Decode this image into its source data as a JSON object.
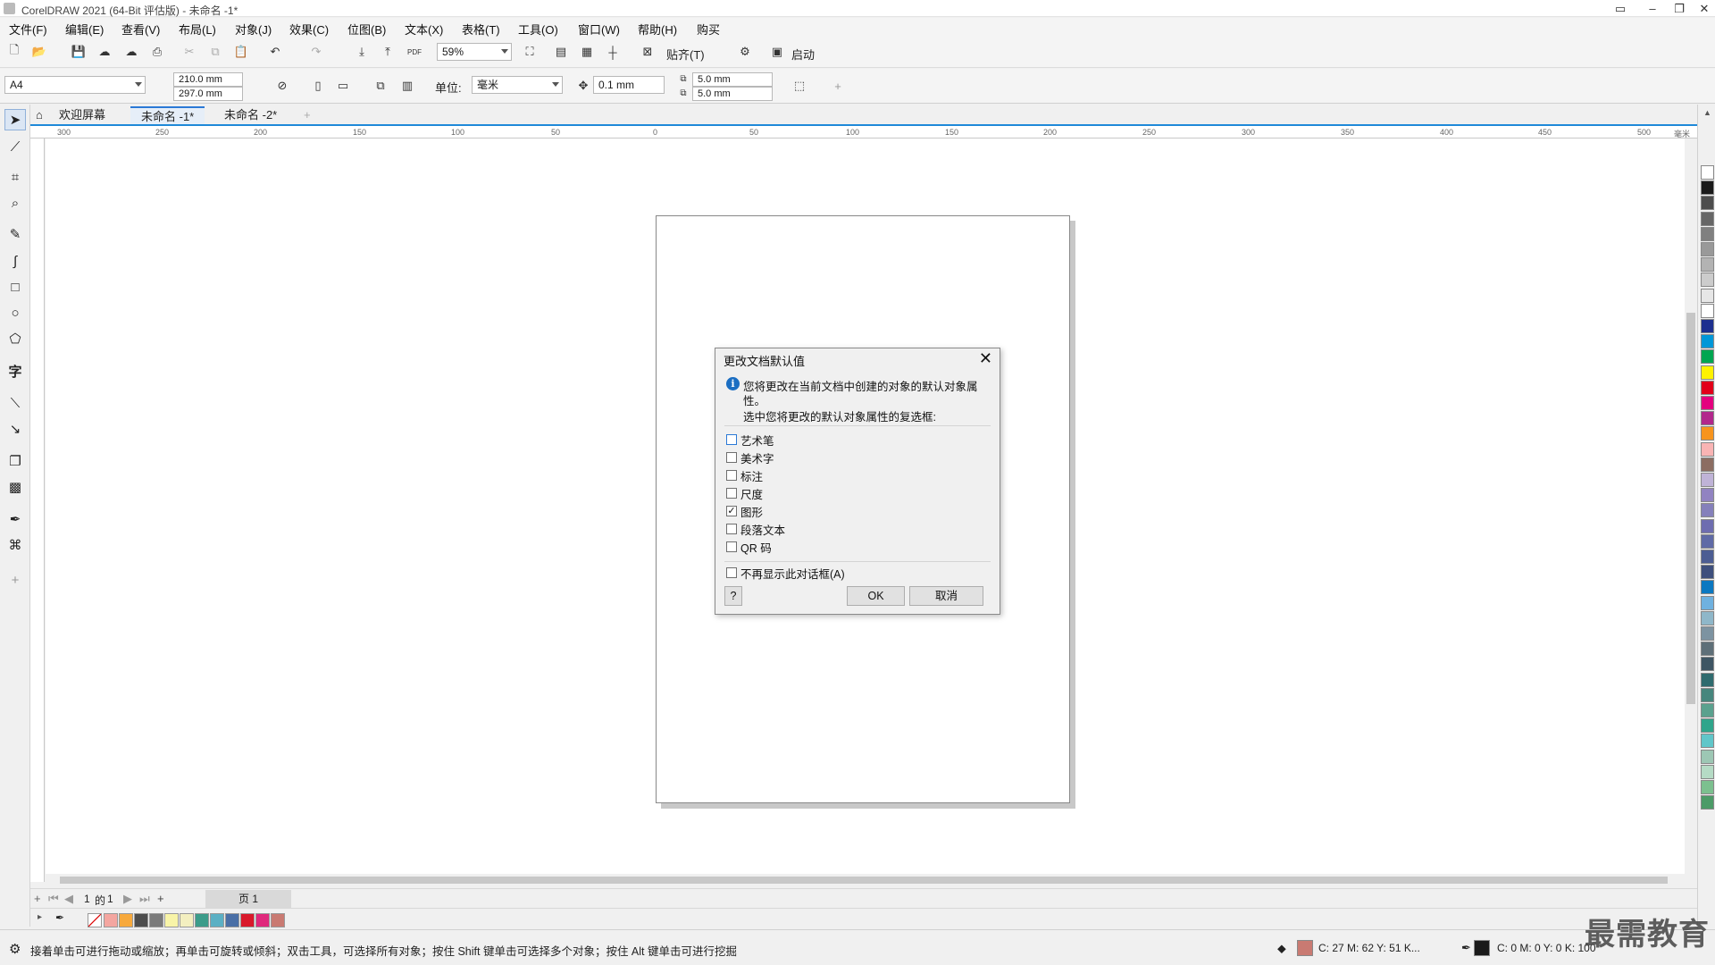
{
  "window": {
    "title": "CorelDRAW 2021 (64-Bit 评估版) - 未命名 -1*"
  },
  "menu": [
    "文件(F)",
    "编辑(E)",
    "查看(V)",
    "布局(L)",
    "对象(J)",
    "效果(C)",
    "位图(B)",
    "文本(X)",
    "表格(T)",
    "工具(O)",
    "窗口(W)",
    "帮助(H)",
    "购买"
  ],
  "toolbar": {
    "zoom": "59%",
    "snap_label": "贴齐(T)",
    "launch_label": "启动"
  },
  "property_bar": {
    "page_size": "A4",
    "width": "210.0 mm",
    "height": "297.0 mm",
    "units_label": "单位:",
    "units_value": "毫米",
    "nudge": "0.1 mm",
    "dup_x": "5.0 mm",
    "dup_y": "5.0 mm"
  },
  "tabs": [
    "欢迎屏幕",
    "未命名 -1*",
    "未命名 -2*"
  ],
  "ruler": {
    "h_ticks": [
      "300",
      "250",
      "200",
      "150",
      "100",
      "50",
      "0",
      "50",
      "100",
      "150",
      "200",
      "250",
      "300",
      "350",
      "400",
      "450",
      "500"
    ],
    "unit": "毫米"
  },
  "page_nav": {
    "current": "1",
    "of_label": "的",
    "total": "1",
    "page_tab": "页 1"
  },
  "status": {
    "hint": "接着单击可进行拖动或缩放；再单击可旋转或倾斜；双击工具，可选择所有对象；按住 Shift 键单击可选择多个对象；按住 Alt 键单击可进行挖掘",
    "fill_values": "C: 27 M: 62 Y: 51 K...",
    "outline_values": "C: 0 M: 0 Y: 0 K: 100"
  },
  "dialog": {
    "title": "更改文档默认值",
    "message_line1": "您将更改在当前文档中创建的对象的默认对象属",
    "message_line2": "性。",
    "instruction": "选中您将更改的默认对象属性的复选框:",
    "options": [
      {
        "label": "艺术笔",
        "checked": false
      },
      {
        "label": "美术字",
        "checked": false
      },
      {
        "label": "标注",
        "checked": false
      },
      {
        "label": "尺度",
        "checked": false
      },
      {
        "label": "图形",
        "checked": true
      },
      {
        "label": "段落文本",
        "checked": false
      },
      {
        "label": "QR 码",
        "checked": false
      }
    ],
    "dont_show": "不再显示此对话框(A)",
    "help_btn": "?",
    "ok_btn": "OK",
    "cancel_btn": "取消"
  },
  "colors": {
    "fill": "#c97a72",
    "outline": "#1a1a1a",
    "bottom_palette": [
      "#f4a6a0",
      "#f7a93c",
      "#4d4d4d",
      "#7a7a7a",
      "#f8f4a8",
      "#f3efc0",
      "#3c9c8a",
      "#5bb0c4",
      "#4a6fa6",
      "#d9192b",
      "#e0297c",
      "#c97a72"
    ],
    "side_palette": [
      "#ffffff",
      "#1a1a1a",
      "#4d4d4d",
      "#666666",
      "#808080",
      "#999999",
      "#b3b3b3",
      "#cccccc",
      "#e6e6e6",
      "#ffffff",
      "#1d2f8f",
      "#0097d8",
      "#00a651",
      "#fff200",
      "#e2001a",
      "#e4007f",
      "#b2278c",
      "#f7941d",
      "#f9b4b4",
      "#8c6d62",
      "#bfb3d7",
      "#9183c1",
      "#8580bb",
      "#6e6db0",
      "#5f6aa6",
      "#4c5d93",
      "#3e4f7d",
      "#0b78c1",
      "#6fb1df",
      "#8fb7c9",
      "#7d93a1",
      "#5e6f78",
      "#3e5563",
      "#2f6b6e",
      "#46867d",
      "#5aa18e",
      "#2fa58b",
      "#60c6c9",
      "#9dc7b4",
      "#b5dbc5",
      "#7cc08f",
      "#4c9b67"
    ]
  },
  "watermark": "最需教育"
}
